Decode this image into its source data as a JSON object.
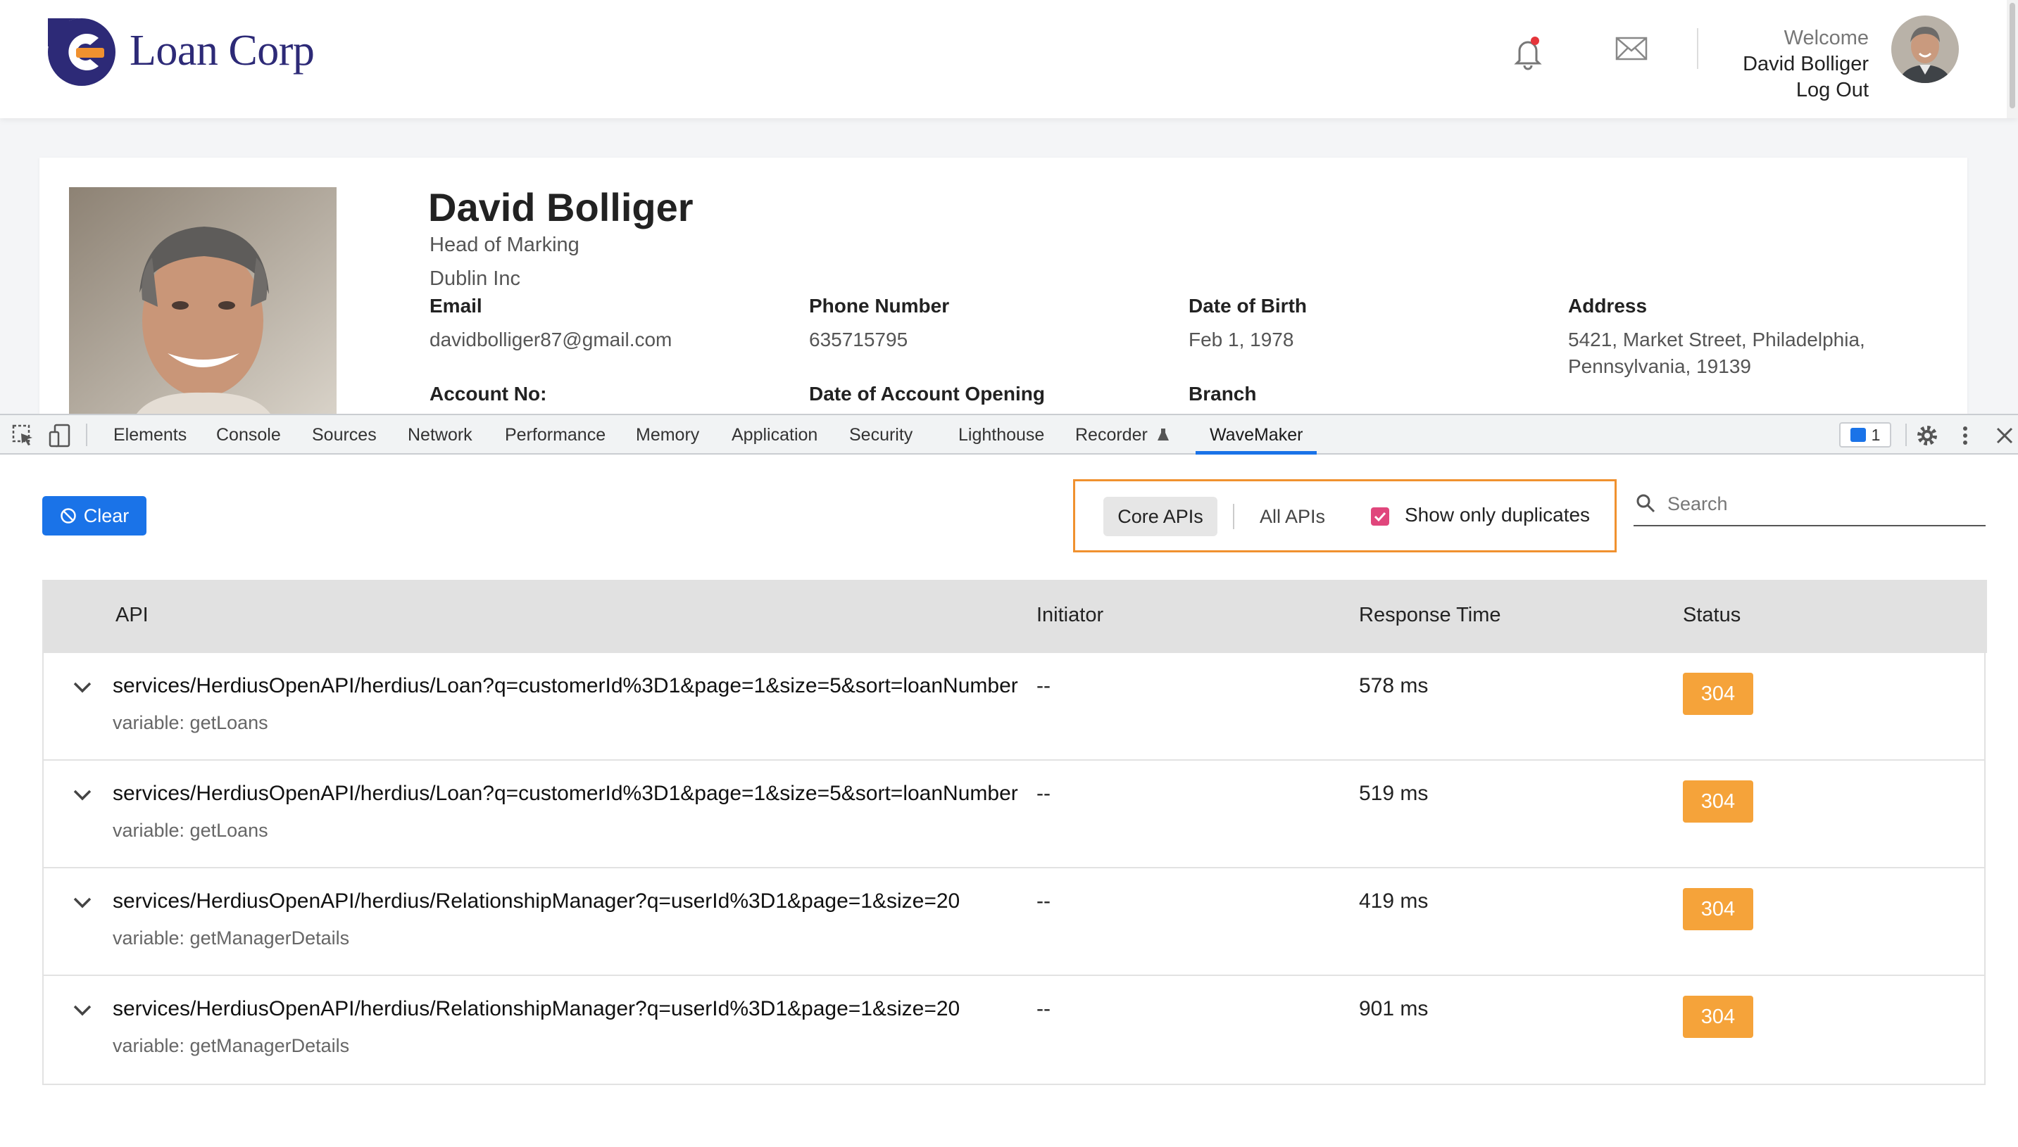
{
  "app": {
    "brand": "Loan Corp",
    "welcome_label": "Welcome",
    "user_name": "David Bolliger",
    "logout_label": "Log Out"
  },
  "profile": {
    "name": "David Bolliger",
    "title": "Head of Marking",
    "company": "Dublin Inc",
    "fields": [
      {
        "label": "Email",
        "value": "davidbolliger87@gmail.com"
      },
      {
        "label": "Phone Number",
        "value": "635715795"
      },
      {
        "label": "Date of Birth",
        "value": "Feb 1, 1978"
      },
      {
        "label": "Address",
        "value": "5421, Market Street, Philadelphia, Pennsylvania, 19139"
      },
      {
        "label": "Account No:",
        "value": ""
      },
      {
        "label": "Date of Account Opening",
        "value": ""
      },
      {
        "label": "Branch",
        "value": ""
      }
    ]
  },
  "devtools": {
    "tabs": [
      "Elements",
      "Console",
      "Sources",
      "Network",
      "Performance",
      "Memory",
      "Application",
      "Security",
      "Lighthouse",
      "Recorder",
      "WaveMaker"
    ],
    "active_tab": "WaveMaker",
    "issues_count": "1"
  },
  "wavemaker": {
    "clear_label": "Clear",
    "core_apis_label": "Core APIs",
    "all_apis_label": "All APIs",
    "show_duplicates_label": "Show only duplicates",
    "show_duplicates_checked": true,
    "search_placeholder": "Search",
    "columns": [
      "API",
      "Initiator",
      "Response Time",
      "Status"
    ],
    "rows": [
      {
        "api": "services/HerdiusOpenAPI/herdius/Loan?q=customerId%3D1&page=1&size=5&sort=loanNumber",
        "variable": "variable: getLoans",
        "initiator": "--",
        "response_time": "578 ms",
        "status": "304"
      },
      {
        "api": "services/HerdiusOpenAPI/herdius/Loan?q=customerId%3D1&page=1&size=5&sort=loanNumber",
        "variable": "variable: getLoans",
        "initiator": "--",
        "response_time": "519 ms",
        "status": "304"
      },
      {
        "api": "services/HerdiusOpenAPI/herdius/RelationshipManager?q=userId%3D1&page=1&size=20",
        "variable": "variable: getManagerDetails",
        "initiator": "--",
        "response_time": "419 ms",
        "status": "304"
      },
      {
        "api": "services/HerdiusOpenAPI/herdius/RelationshipManager?q=userId%3D1&page=1&size=20",
        "variable": "variable: getManagerDetails",
        "initiator": "--",
        "response_time": "901 ms",
        "status": "304"
      }
    ]
  },
  "colors": {
    "brand_navy": "#2d2a77",
    "brand_orange": "#f0912f",
    "devtools_blue": "#1a73e8",
    "status_badge": "#f5a33a",
    "checkbox_pink": "#e0467c"
  }
}
